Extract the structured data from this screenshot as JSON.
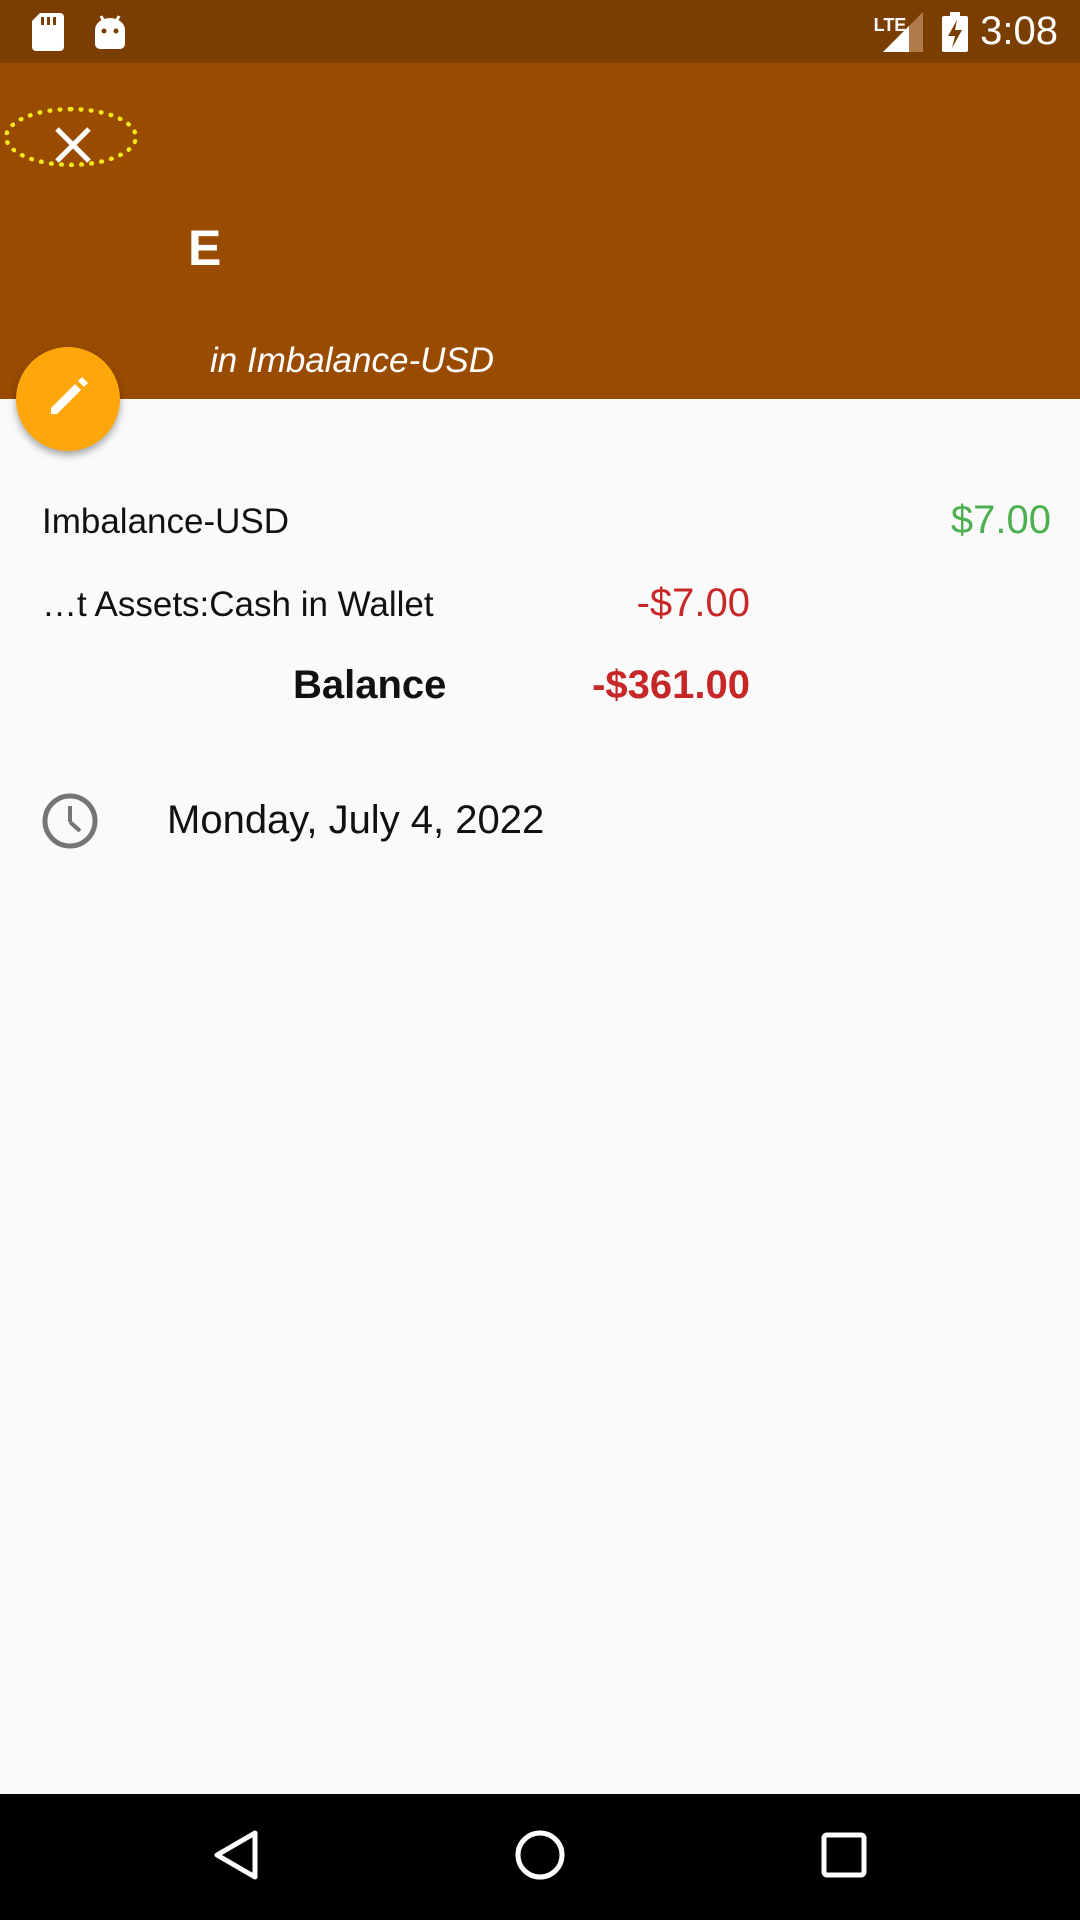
{
  "status_bar": {
    "time": "3:08",
    "network_label": "LTE",
    "icons": [
      "sd-card-icon",
      "android-icon",
      "signal-icon",
      "battery-charging-icon"
    ]
  },
  "header": {
    "close_icon": "close-icon",
    "title": "E",
    "subtitle": "in Imbalance-USD",
    "edit_icon": "pencil-icon"
  },
  "splits": [
    {
      "account": "Imbalance-USD",
      "amount": "$7.00",
      "color": "#4caf50"
    },
    {
      "account": "…t Assets:Cash in Wallet",
      "amount": "-$7.00",
      "color": "#c62828"
    }
  ],
  "balance": {
    "label": "Balance",
    "amount": "-$361.00",
    "color": "#c62828"
  },
  "date": {
    "icon": "clock-icon",
    "text": "Monday, July 4, 2022"
  },
  "nav": [
    "back-icon",
    "home-icon",
    "recents-icon"
  ],
  "colors": {
    "status_bar": "#7a3f00",
    "app_bar": "#994c00",
    "fab": "#ffa60a",
    "focus_ring": "#f5e91a"
  }
}
